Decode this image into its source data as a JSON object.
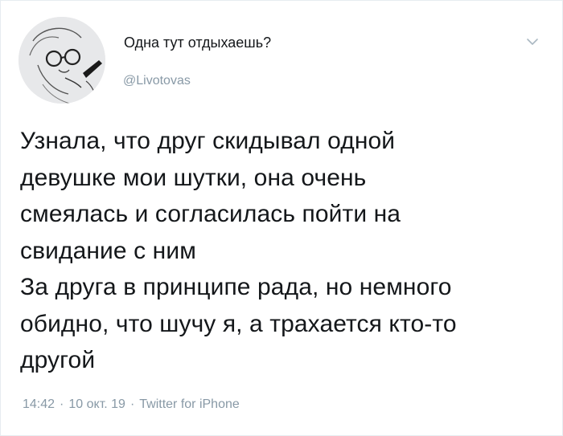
{
  "author": {
    "display_name": "Одна тут отдыхаешь?",
    "handle": "@Livotovas",
    "avatar_icon": "avatar-sketch-icon"
  },
  "tweet": {
    "paragraphs": [
      "Узнала, что друг скидывал одной\nдевушке мои шутки, она очень\nсмеялась и согласилась пойти на\nсвидание с ним",
      "За друга в принципе рада, но немного\nобидно, что шучу я, а трахается кто-то\nдругой"
    ]
  },
  "meta": {
    "time": "14:42",
    "date": "10 окт. 19",
    "source": "Twitter for iPhone",
    "separator": "·"
  },
  "icons": {
    "menu_caret": "chevron-down-icon"
  },
  "colors": {
    "text": "#14171a",
    "secondary": "#8899a6",
    "border": "#e6ecf0"
  }
}
